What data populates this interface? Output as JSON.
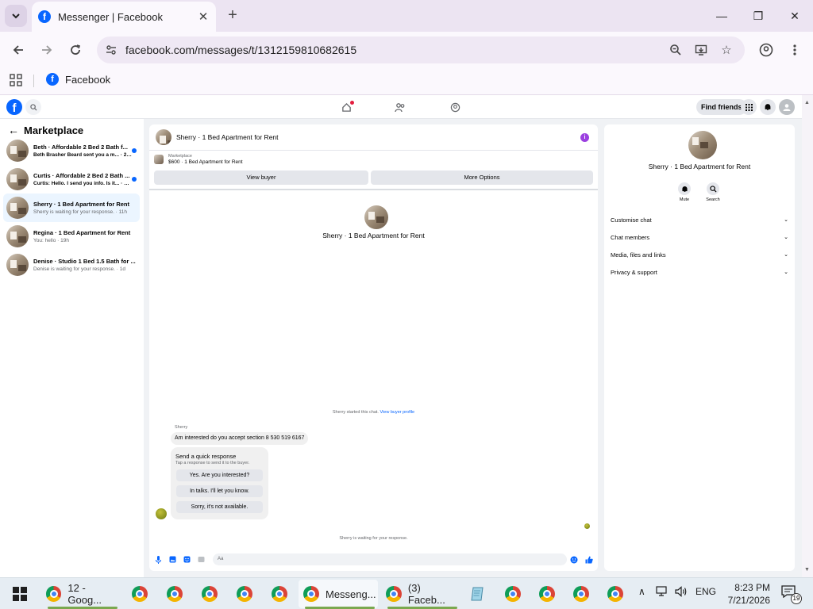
{
  "browser": {
    "tab_title": "Messenger | Facebook",
    "url": "facebook.com/messages/t/1312159810682615",
    "bookmark_label": "Facebook",
    "tab_favicon": "f",
    "bookmark_favicon": "f"
  },
  "fb_top": {
    "logo": "f",
    "find_friends": "Find friends"
  },
  "sidebar": {
    "title": "Marketplace",
    "conversations": [
      {
        "title": "Beth · Affordable 2 Bed 2 Bath f...",
        "preview": "Beth Brasher Beard sent you a m... · 25m",
        "unread": true,
        "active": false
      },
      {
        "title": "Curtis · Affordable 2 Bed 2 Bath ...",
        "preview": "Curtis: Hello. I send you info. Is it... · 10h",
        "unread": true,
        "active": false
      },
      {
        "title": "Sherry · 1 Bed Apartment for Rent",
        "preview": "Sherry is waiting for your response. · 11h",
        "unread": false,
        "active": true
      },
      {
        "title": "Regina · 1 Bed Apartment for Rent",
        "preview": "You: hello · 19h",
        "unread": false,
        "active": false
      },
      {
        "title": "Denise · Studio 1 Bed 1.5 Bath for ...",
        "preview": "Denise is waiting for your response. · 1d",
        "unread": false,
        "active": false
      }
    ]
  },
  "chat": {
    "header_name": "Sherry · 1 Bed Apartment for Rent",
    "listing_source": "Marketplace",
    "listing_price_title": "$600 · 1 Bed Apartment for Rent",
    "view_buyer": "View buyer",
    "more_options": "More Options",
    "center_name": "Sherry · 1 Bed Apartment for Rent",
    "started_text": "Sherry started this chat.",
    "view_buyer_profile": "View buyer profile",
    "sender_name": "Sherry",
    "message": "Am interested do you accept section 8 530 519 6167",
    "quick_title": "Send a quick response",
    "quick_subtitle": "Tap a response to send it to the buyer.",
    "quick_replies": [
      "Yes. Are you interested?",
      "In talks. I'll let you know.",
      "Sorry, it's not available."
    ],
    "waiting_text": "Sherry is waiting for your response.",
    "composer_placeholder": "Aa"
  },
  "info_panel": {
    "name": "Sherry · 1 Bed Apartment for Rent",
    "mute_label": "Mute",
    "search_label": "Search",
    "sections": [
      "Customise chat",
      "Chat members",
      "Media, files and links",
      "Privacy & support"
    ]
  },
  "taskbar": {
    "chrome_window_label": "12 - Goog...",
    "messenger_label": "Messeng...",
    "facebook_label": "(3) Faceb...",
    "language": "ENG",
    "time": "8:23 PM",
    "date": "7/21/2026",
    "notification_count": "19"
  },
  "colors": {
    "facebook_blue": "#0866ff",
    "info_purple": "#9b40e0",
    "active_conversation_bg": "#ebf5ff"
  }
}
